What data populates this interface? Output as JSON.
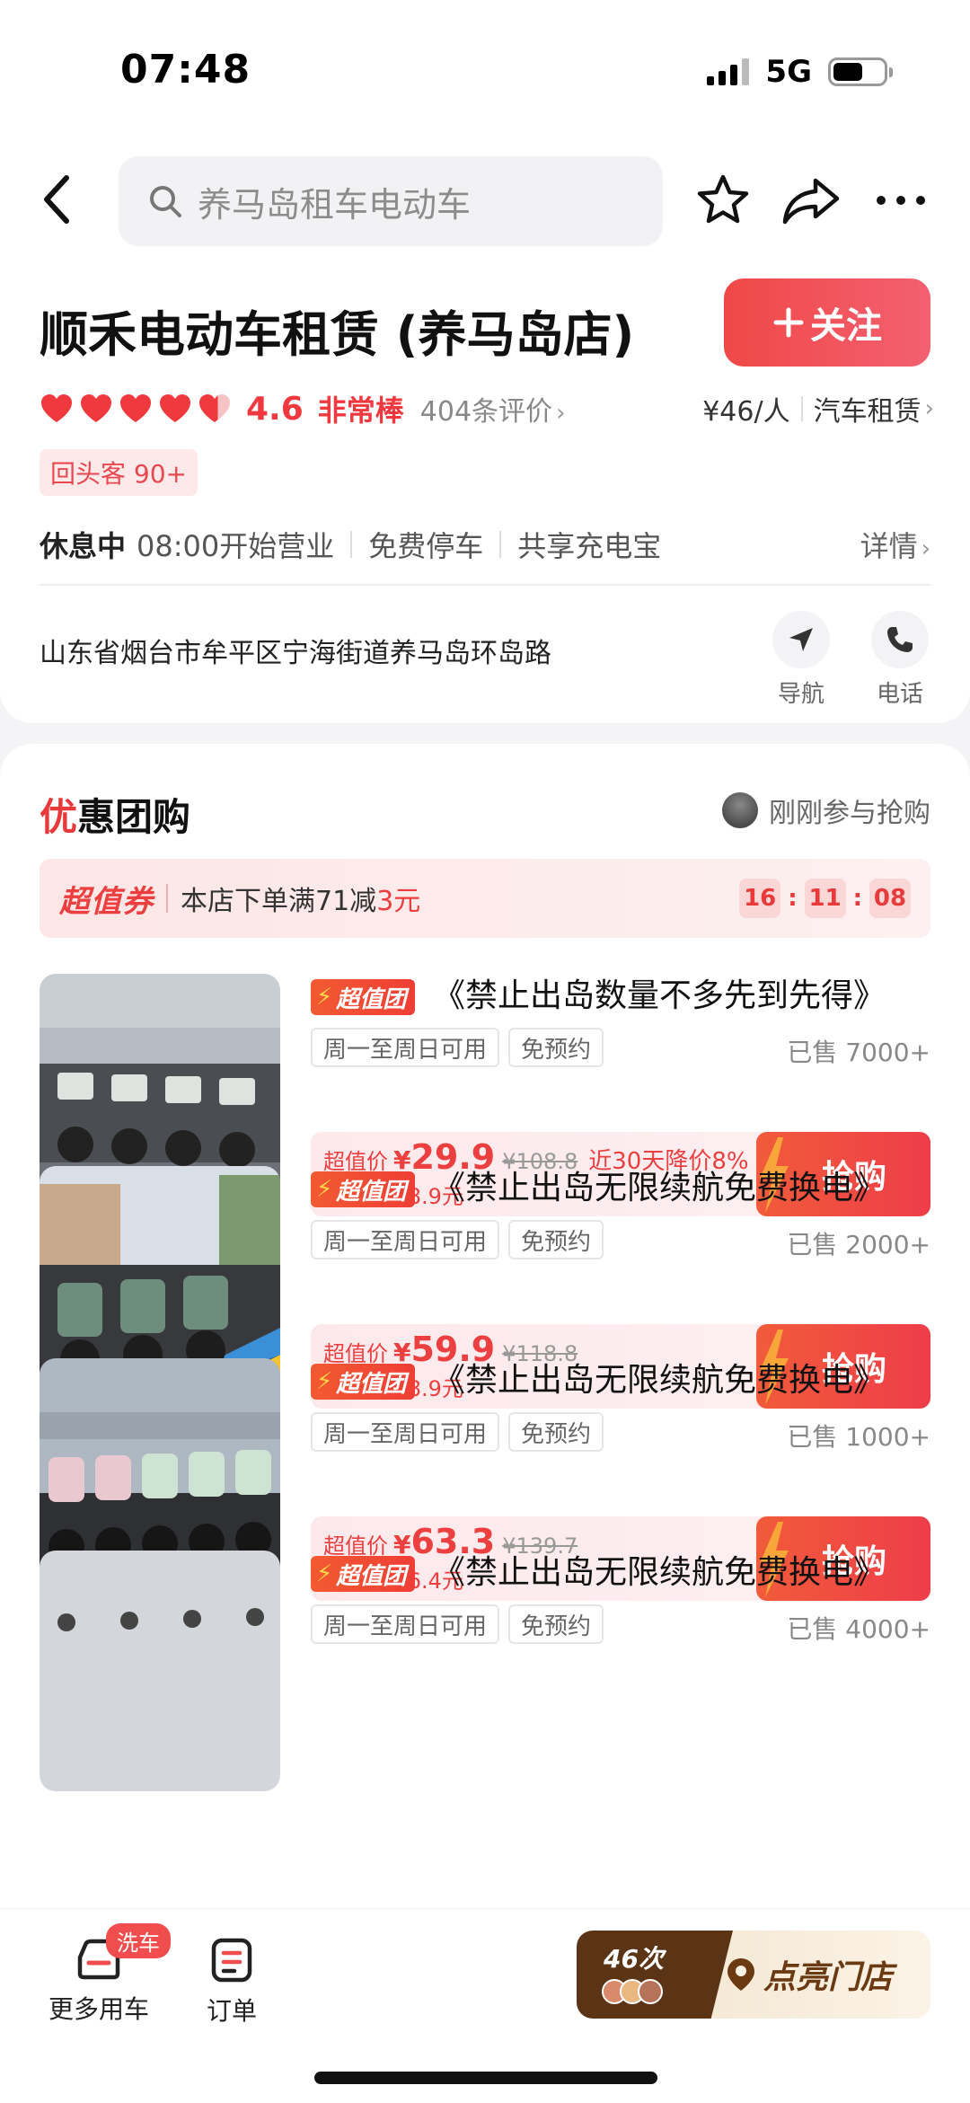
{
  "status_bar": {
    "time": "07:48",
    "network": "5G",
    "battery_level": 0.6
  },
  "search": {
    "placeholder": "养马岛租车电动车"
  },
  "shop": {
    "name": "顺禾电动车租赁 (养马岛店)",
    "follow_label": "关注",
    "rating": "4.6",
    "rating_text": "非常棒",
    "reviews": "404条评价",
    "price_per_person": "¥46/人",
    "category": "汽车租赁",
    "repeat_tag": "回头客 90+",
    "status": "休息中",
    "open_time": "08:00开始营业",
    "feature_1": "免费停车",
    "feature_2": "共享充电宝",
    "details": "详情",
    "address": "山东省烟台市牟平区宁海街道养马岛环岛路",
    "nav_label": "导航",
    "phone_label": "电话"
  },
  "deals": {
    "title_first": "优",
    "title_rest": "惠团购",
    "recent": "刚刚参与抢购",
    "coupon": {
      "brand": "超值券",
      "text": "本店下单满71减",
      "amount": "3元",
      "timer": [
        "16",
        "11",
        "08"
      ]
    },
    "badge_label": "超值团",
    "price_label": "超值价",
    "buy_label": "抢购",
    "items": [
      {
        "title": "《禁止出岛数量不多先到先得》",
        "tag1": "周一至周日可用",
        "tag2": "免预约",
        "sold": "已售 7000+",
        "price": "29.9",
        "original": "¥108.8",
        "extra": "近30天降价8%",
        "drop": "直降78.9元"
      },
      {
        "title": "《禁止出岛无限续航免费换电》",
        "tag1": "周一至周日可用",
        "tag2": "免预约",
        "sold": "已售 2000+",
        "price": "59.9",
        "original": "¥118.8",
        "extra": "",
        "drop": "直降58.9元"
      },
      {
        "title": "《禁止出岛无限续航免费换电》",
        "tag1": "周一至周日可用",
        "tag2": "免预约",
        "sold": "已售 1000+",
        "price": "63.3",
        "original": "¥139.7",
        "extra": "",
        "drop": "直降76.4元"
      },
      {
        "title": "《禁止出岛无限续航免费换电》",
        "tag1": "周一至周日可用",
        "tag2": "免预约",
        "sold": "已售 4000+"
      }
    ]
  },
  "bottom_bar": {
    "more_cars": "更多用车",
    "wash_badge": "洗车",
    "orders": "订单",
    "light_count": "46次",
    "light_label": "点亮门店"
  },
  "colors": {
    "accent": "#ec3f3f",
    "brown": "#5a3414"
  }
}
